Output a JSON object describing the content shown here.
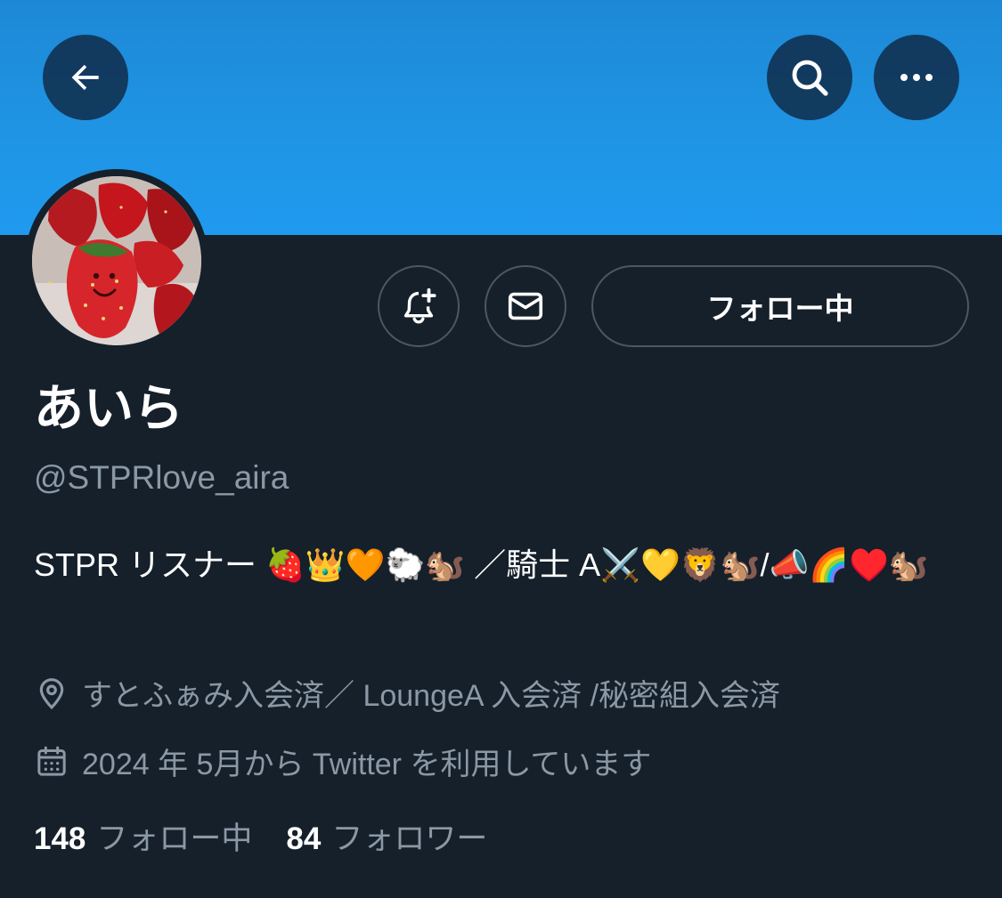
{
  "profile": {
    "display_name": "あいら",
    "handle": "@STPRlove_aira",
    "bio": "STPR リスナー 🍓👑🧡🐑🐿️ ／騎士 A⚔️💛🦁🐿️/📣🌈♥️🐿️",
    "location": "すとふぁみ入会済／ LoungeA 入会済 /秘密組入会済",
    "joined": "2024 年 5月から Twitter を利用しています",
    "following_count": "148",
    "following_label": "フォロー中",
    "followers_count": "84",
    "followers_label": "フォロワー"
  },
  "actions": {
    "follow_button_label": "フォロー中"
  },
  "icons": {
    "back": "arrow-left-icon",
    "search": "search-icon",
    "more": "more-horizontal-icon",
    "notify": "bell-plus-icon",
    "message": "envelope-icon",
    "location": "location-pin-icon",
    "calendar": "calendar-icon"
  },
  "colors": {
    "banner": "#1f94e3",
    "background": "#15202B",
    "secondary_text": "#8b98a5",
    "border": "#4a5866"
  }
}
